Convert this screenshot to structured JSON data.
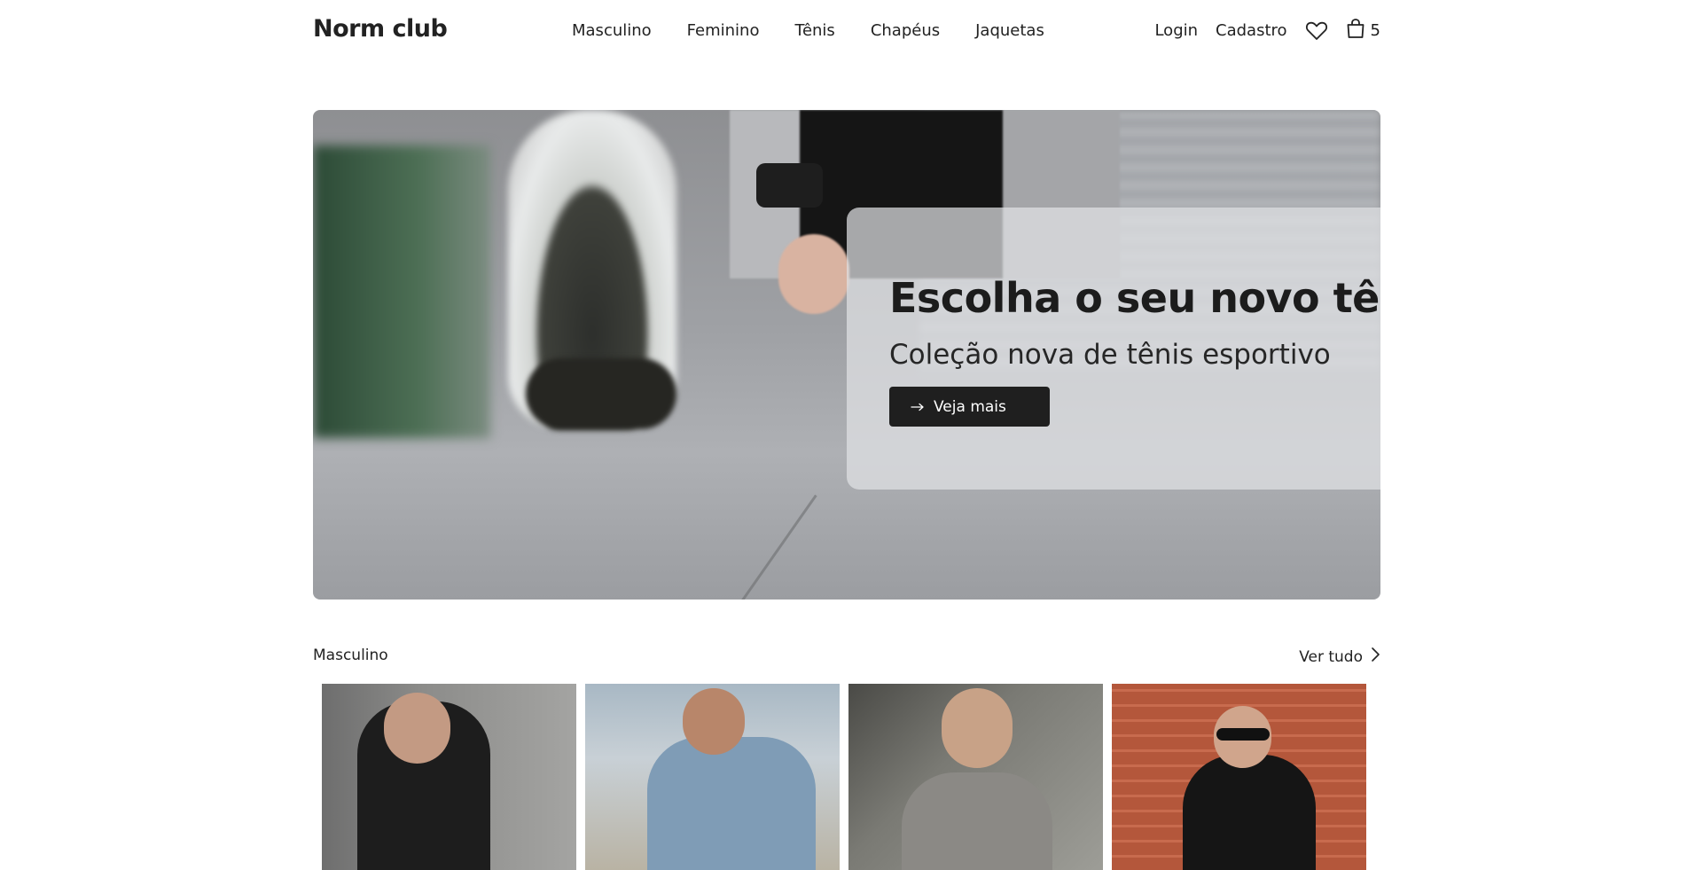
{
  "header": {
    "brand": "Norm club",
    "nav": [
      "Masculino",
      "Feminino",
      "Tênis",
      "Chapéus",
      "Jaquetas"
    ],
    "login": "Login",
    "signup": "Cadastro",
    "wishlist_icon": "heart-icon",
    "cart_icon": "bag-icon",
    "cart_count": "5"
  },
  "hero": {
    "title": "Escolha o seu novo tênis",
    "subtitle": "Coleção nova de tênis esportivo",
    "button_label": "Veja mais",
    "button_icon": "arrow-right-icon"
  },
  "section": {
    "title": "Masculino",
    "see_all": "Ver tudo",
    "see_all_icon": "chevron-right-icon"
  },
  "colors": {
    "button_bg": "#1f1f1f",
    "text": "#1a1a1a"
  }
}
